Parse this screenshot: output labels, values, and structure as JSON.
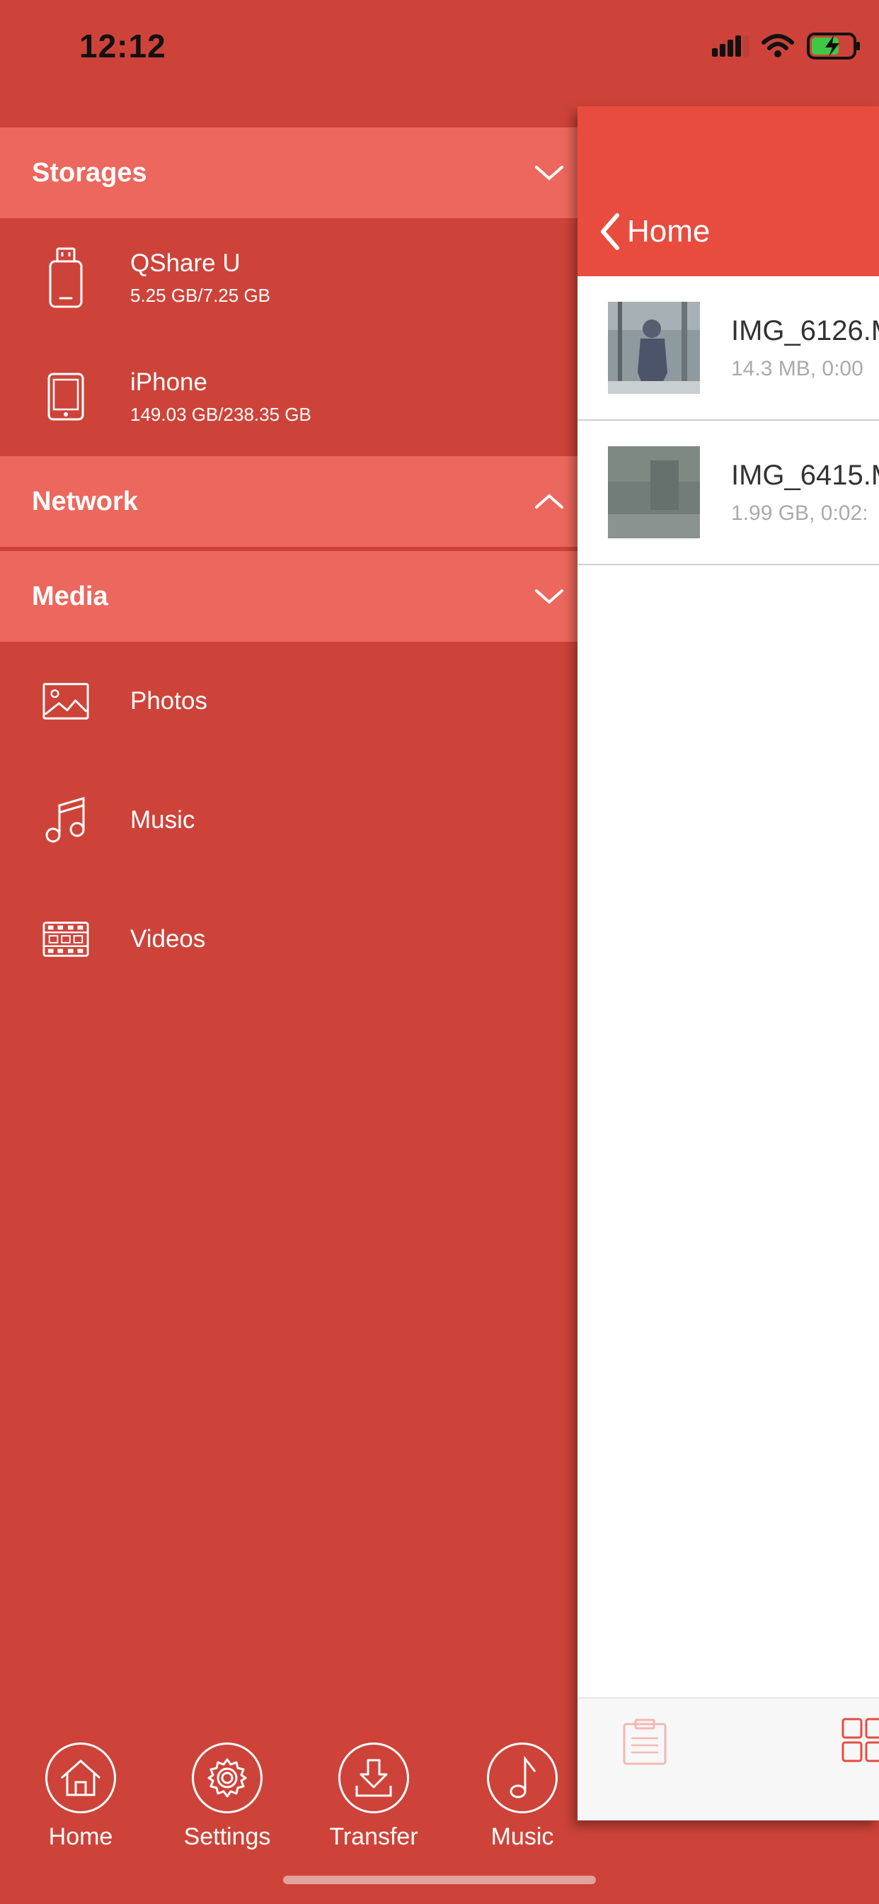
{
  "status": {
    "time": "12:12"
  },
  "sidebar": {
    "storages": {
      "title": "Storages",
      "items": [
        {
          "label": "QShare U",
          "sub": "5.25 GB/7.25 GB",
          "icon": "usb-drive-icon"
        },
        {
          "label": "iPhone",
          "sub": "149.03 GB/238.35 GB",
          "icon": "phone-icon"
        }
      ]
    },
    "network": {
      "title": "Network"
    },
    "media": {
      "title": "Media",
      "items": [
        {
          "label": "Photos",
          "icon": "photo-icon"
        },
        {
          "label": "Music",
          "icon": "music-note-icon"
        },
        {
          "label": "Videos",
          "icon": "film-icon"
        }
      ]
    }
  },
  "bottom_nav": [
    {
      "label": "Home",
      "icon": "home-icon"
    },
    {
      "label": "Settings",
      "icon": "gear-icon"
    },
    {
      "label": "Transfer",
      "icon": "download-icon"
    },
    {
      "label": "Music",
      "icon": "music-note-icon"
    }
  ],
  "panel": {
    "back_label": "Home",
    "files": [
      {
        "name": "IMG_6126.M",
        "meta": "14.3 MB, 0:00"
      },
      {
        "name": "IMG_6415.M",
        "meta": "1.99 GB, 0:02:"
      }
    ]
  },
  "colors": {
    "sidebar_bg": "#CD4339",
    "section_bg": "#EC675D",
    "header_bg": "#E74C3F"
  }
}
